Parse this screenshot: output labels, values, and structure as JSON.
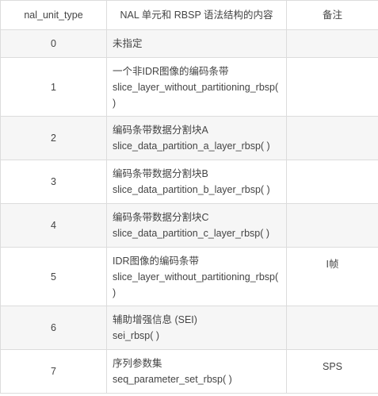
{
  "header": {
    "col_type": "nal_unit_type",
    "col_content": "NAL 单元和 RBSP 语法结构的内容",
    "col_note": "备注"
  },
  "rows": [
    {
      "type": "0",
      "lines": [
        "未指定"
      ],
      "note": ""
    },
    {
      "type": "1",
      "lines": [
        "一个非IDR图像的编码条带",
        "slice_layer_without_partitioning_rbsp(",
        ")"
      ],
      "note": ""
    },
    {
      "type": "2",
      "lines": [
        "编码条带数据分割块A",
        "slice_data_partition_a_layer_rbsp( )"
      ],
      "note": ""
    },
    {
      "type": "3",
      "lines": [
        "编码条带数据分割块B",
        "slice_data_partition_b_layer_rbsp( )"
      ],
      "note": ""
    },
    {
      "type": "4",
      "lines": [
        "编码条带数据分割块C",
        "slice_data_partition_c_layer_rbsp( )"
      ],
      "note": ""
    },
    {
      "type": "5",
      "lines": [
        "IDR图像的编码条带",
        "slice_layer_without_partitioning_rbsp(",
        ")"
      ],
      "note": "I帧"
    },
    {
      "type": "6",
      "lines": [
        "辅助增强信息 (SEI)",
        "sei_rbsp( )"
      ],
      "note": ""
    },
    {
      "type": "7",
      "lines": [
        "序列参数集",
        "seq_parameter_set_rbsp( )"
      ],
      "note": "SPS"
    }
  ]
}
